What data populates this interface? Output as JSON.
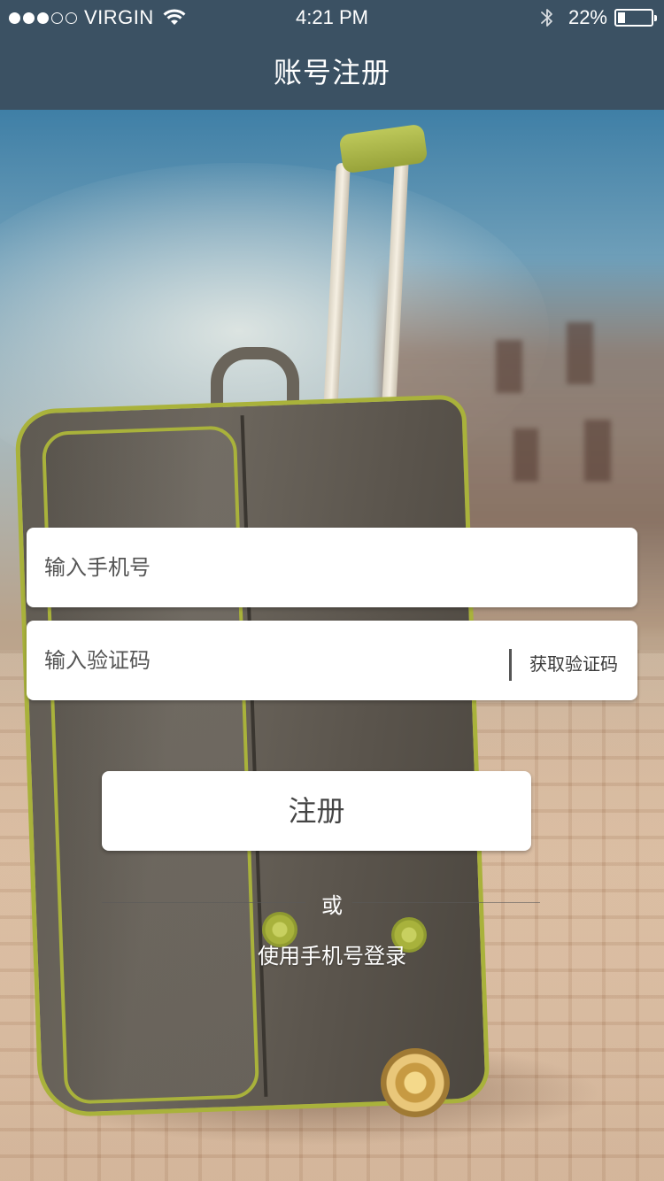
{
  "status_bar": {
    "carrier": "VIRGIN",
    "signal_filled": 3,
    "signal_total": 5,
    "time": "4:21 PM",
    "battery_percent": "22%",
    "icons": [
      "signal-dots-icon",
      "wifi-icon",
      "bluetooth-icon",
      "battery-icon"
    ]
  },
  "nav": {
    "title": "账号注册",
    "background": "#3b5163"
  },
  "form": {
    "phone_placeholder": "输入手机号",
    "code_placeholder": "输入验证码",
    "get_code_label": "获取验证码",
    "register_label": "注册",
    "or_label": "或",
    "phone_login_label": "使用手机号登录"
  },
  "colors": {
    "header": "#3b5163",
    "field_bg": "#ffffff",
    "text_dark": "#444444",
    "text_light": "#ffffff"
  }
}
